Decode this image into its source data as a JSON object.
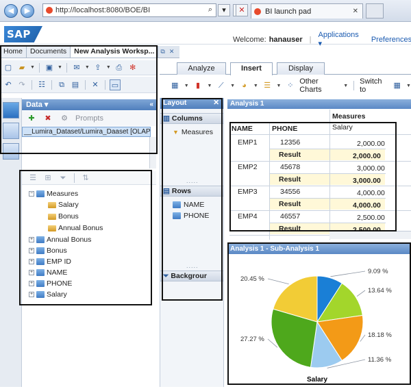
{
  "browser": {
    "url": "http://localhost:8080/BOE/BI",
    "tab_title": "BI launch pad",
    "tab_close": "✕",
    "back": "◀",
    "forward": "▶",
    "search_glyph": "⌕",
    "go_glyph": "▾",
    "refresh_glyph": "↻",
    "stop_glyph": "✕"
  },
  "header": {
    "logo": "SAP",
    "welcome_label": "Welcome:",
    "username": "hanauser",
    "sep": "|",
    "applications": "Applications ▾",
    "preferences": "Preferences"
  },
  "workspace_tabs": [
    {
      "label": "Home"
    },
    {
      "label": "Documents"
    },
    {
      "label": "New Analysis Worksp..."
    }
  ],
  "main_tabs": [
    {
      "label": "Analyze"
    },
    {
      "label": "Insert"
    },
    {
      "label": "Display"
    }
  ],
  "insert_toolbar": {
    "other_charts": "Other Charts",
    "switch_to": "Switch to"
  },
  "data_panel": {
    "title": "Data ▾",
    "collapse": "«",
    "prompts": "Prompts",
    "source": "__Lumira_Dataset/Lumira_Daaset [OLAP_H..."
  },
  "tree": [
    {
      "label": "Measures",
      "expanded": true,
      "type": "folder"
    },
    {
      "label": "Salary",
      "type": "measure"
    },
    {
      "label": "Bonus",
      "type": "measure"
    },
    {
      "label": "Annual Bonus",
      "type": "measure"
    },
    {
      "label": "Annual Bonus",
      "type": "folder"
    },
    {
      "label": "Bonus",
      "type": "folder"
    },
    {
      "label": "EMP ID",
      "type": "folder"
    },
    {
      "label": "NAME",
      "type": "folder"
    },
    {
      "label": "PHONE",
      "type": "folder"
    },
    {
      "label": "Salary",
      "type": "folder"
    }
  ],
  "layout_panel": {
    "title": "Layout",
    "close": "✕",
    "columns_header": "Columns",
    "columns": [
      "Measures"
    ],
    "rows_header": "Rows",
    "rows": [
      "NAME",
      "PHONE"
    ],
    "background_header": "Backgrour",
    "grip": "....."
  },
  "analysis": {
    "title": "Analysis 1",
    "measures_header": "Measures",
    "measure_name": "Salary",
    "col_name": "NAME",
    "col_phone": "PHONE",
    "result_label": "Result",
    "rows": [
      {
        "name": "EMP1",
        "phone": "12356",
        "value": "2,000.00",
        "result": "2,000.00"
      },
      {
        "name": "EMP2",
        "phone": "45678",
        "value": "3,000.00",
        "result": "3,000.00"
      },
      {
        "name": "EMP3",
        "phone": "34556",
        "value": "4,000.00",
        "result": "4,000.00"
      },
      {
        "name": "EMP4",
        "phone": "46557",
        "value": "2,500.00",
        "result": "2,500.00"
      }
    ]
  },
  "sub_analysis": {
    "title": "Analysis 1 - Sub-Analysis 1"
  },
  "chart_data": {
    "type": "pie",
    "title": "",
    "xlabel": "Salary",
    "ylabel": "",
    "series": [
      {
        "values": [
          9.09,
          13.64,
          18.18,
          11.36,
          27.27,
          20.45
        ]
      }
    ],
    "labels": [
      "9.09 %",
      "13.64 %",
      "18.18 %",
      "11.36 %",
      "27.27 %",
      "20.45 %"
    ],
    "colors": [
      "#1a7fd6",
      "#a3d62b",
      "#f39a17",
      "#9ccbf0",
      "#4ea81c",
      "#f2cc36"
    ],
    "legend": "none",
    "grid": false
  }
}
